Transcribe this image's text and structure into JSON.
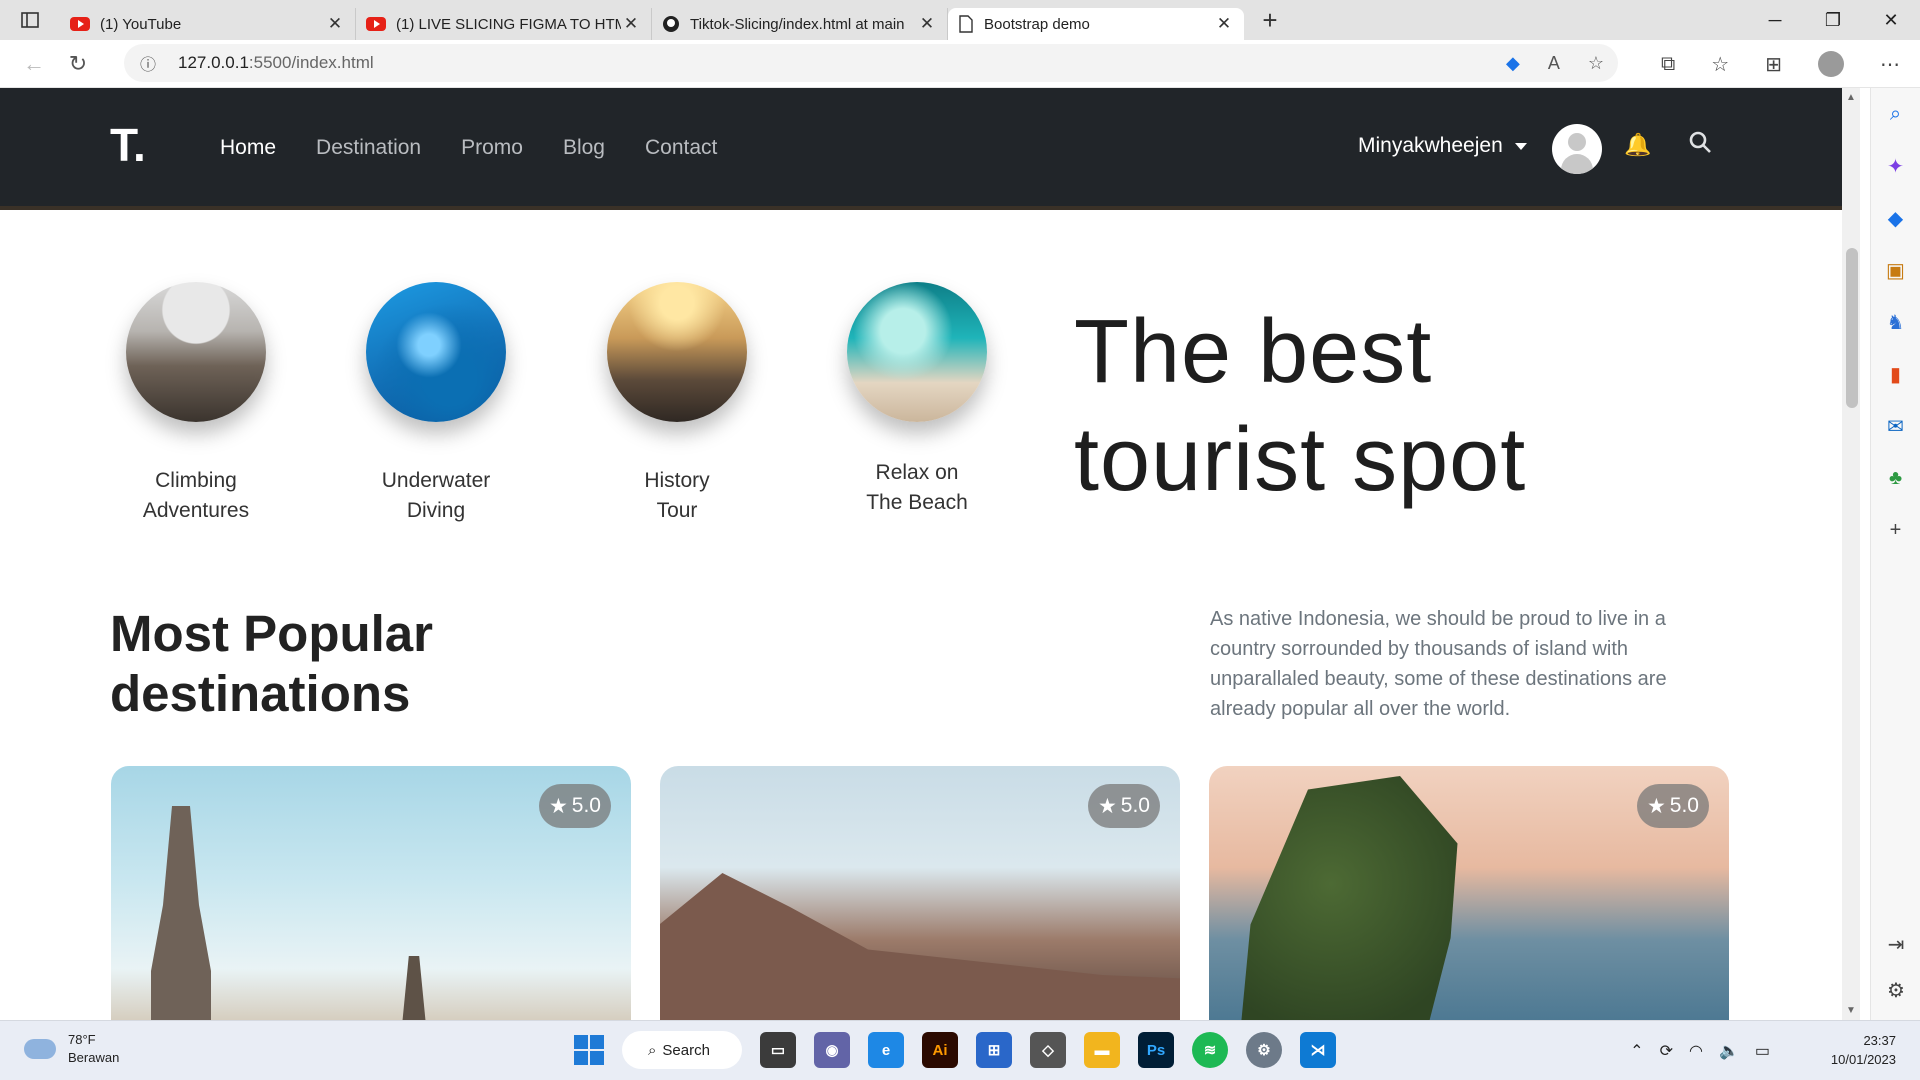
{
  "browser": {
    "tabs": [
      {
        "title": "(1) YouTube",
        "icon": "youtube-icon"
      },
      {
        "title": "(1) LIVE SLICING FIGMA TO HTML",
        "icon": "youtube-icon"
      },
      {
        "title": "Tiktok-Slicing/index.html at main",
        "icon": "github-icon"
      },
      {
        "title": "Bootstrap demo",
        "icon": "document-icon"
      }
    ],
    "url_host": "127.0.0.1",
    "url_path": ":5500/index.html"
  },
  "site": {
    "logo": "T.",
    "nav": [
      "Home",
      "Destination",
      "Promo",
      "Blog",
      "Contact"
    ],
    "user_name": "Minyakwheejen"
  },
  "categories": [
    {
      "label": "Climbing\nAdventures"
    },
    {
      "label": "Underwater\nDiving"
    },
    {
      "label": "History\nTour"
    },
    {
      "label": "Relax on\nThe Beach"
    }
  ],
  "hero": {
    "title_line1": "The best",
    "title_line2": "tourist spot"
  },
  "popular": {
    "title_line1": "Most Popular",
    "title_line2": "destinations",
    "description": "As native Indonesia, we should be proud to live in a country sorrounded by thousands of island with unparallaled beauty, some of these destinations are already popular all over the world.",
    "cards": [
      {
        "rating": "5.0"
      },
      {
        "rating": "5.0"
      },
      {
        "rating": "5.0"
      }
    ]
  },
  "taskbar": {
    "temp": "78°F",
    "weather": "Berawan",
    "search_label": "Search",
    "time": "23:37",
    "date": "10/01/2023"
  }
}
